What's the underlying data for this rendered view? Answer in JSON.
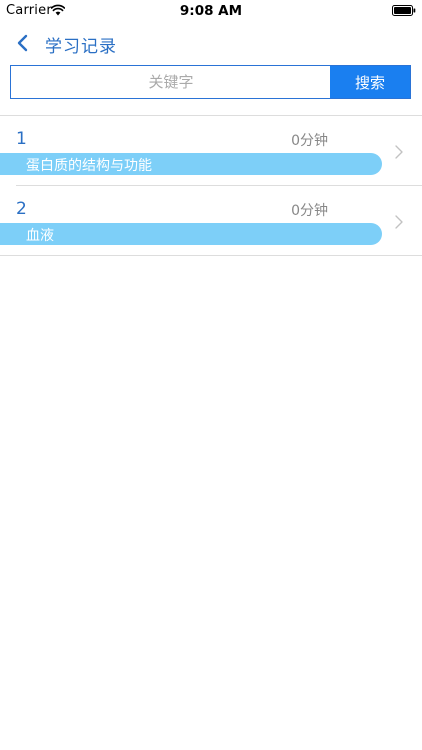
{
  "status_bar": {
    "carrier": "Carrier",
    "time": "9:08 AM"
  },
  "nav": {
    "title": "学习记录"
  },
  "search": {
    "placeholder": "关键字",
    "value": "",
    "button_label": "搜索"
  },
  "records": [
    {
      "number": "1",
      "duration": "0分钟",
      "name": "蛋白质的结构与功能"
    },
    {
      "number": "2",
      "duration": "0分钟",
      "name": "血液"
    }
  ],
  "colors": {
    "accent": "#2a6fc4",
    "search_button": "#1a7ff0",
    "pill": "#7dcff8"
  }
}
